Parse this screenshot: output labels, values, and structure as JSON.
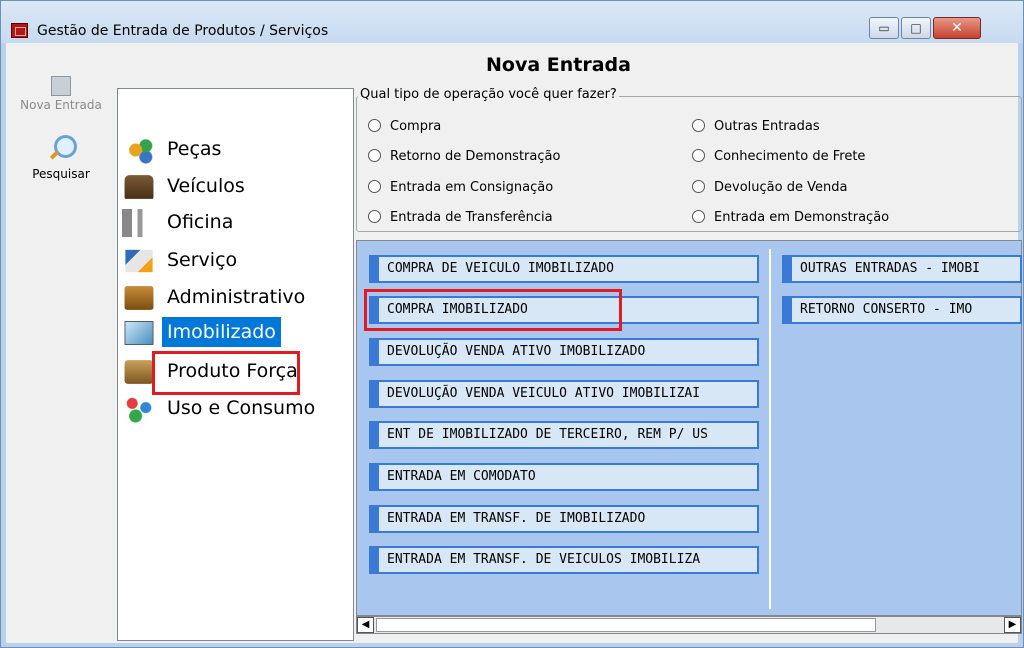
{
  "window": {
    "title": "Gestão de Entrada de Produtos / Serviços",
    "controls": {
      "minimize": "▭",
      "maximize": "□",
      "close": "✕"
    }
  },
  "toolbar": {
    "new_entry_label": "Nova Entrada",
    "search_label": "Pesquisar"
  },
  "heading": "Nova Entrada",
  "categories": [
    {
      "label": "Peças",
      "icon": "parts-icon"
    },
    {
      "label": "Veículos",
      "icon": "truck-icon"
    },
    {
      "label": "Oficina",
      "icon": "wrench-icon"
    },
    {
      "label": "Serviço",
      "icon": "service-icon"
    },
    {
      "label": "Administrativo",
      "icon": "briefcase-icon"
    },
    {
      "label": "Imobilizado",
      "icon": "picture-icon",
      "selected": true
    },
    {
      "label": "Produto Força",
      "icon": "box-icon"
    },
    {
      "label": "Uso e Consumo",
      "icon": "people-icon"
    }
  ],
  "operation_group": {
    "legend": "Qual tipo de operação você quer fazer?",
    "options_left": [
      "Compra",
      "Retorno de Demonstração",
      "Entrada em Consignação",
      "Entrada de Transferência"
    ],
    "options_right": [
      "Outras Entradas",
      "Conhecimento de Frete",
      "Devolução de Venda",
      "Entrada em Demonstração"
    ]
  },
  "operations": {
    "column1": [
      "COMPRA DE VEICULO IMOBILIZADO",
      "COMPRA IMOBILIZADO",
      "DEVOLUÇÃO VENDA ATIVO IMOBILIZADO",
      "DEVOLUÇÃO VENDA VEICULO ATIVO IMOBILIZAI",
      "ENT DE IMOBILIZADO DE TERCEIRO, REM P/ US",
      "ENTRADA EM COMODATO",
      "ENTRADA EM TRANSF. DE IMOBILIZADO",
      "ENTRADA EM TRANSF. DE VEICULOS IMOBILIZA"
    ],
    "column2": [
      "OUTRAS ENTRADAS - IMOBI",
      "RETORNO CONSERTO - IMO"
    ]
  },
  "scrollbar": {
    "left": "◀",
    "right": "▶"
  },
  "colors": {
    "selection": "#0078d7",
    "highlight": "#e21b23",
    "list_bg": "#a9c6ee",
    "item_border": "#3a7ad6"
  }
}
